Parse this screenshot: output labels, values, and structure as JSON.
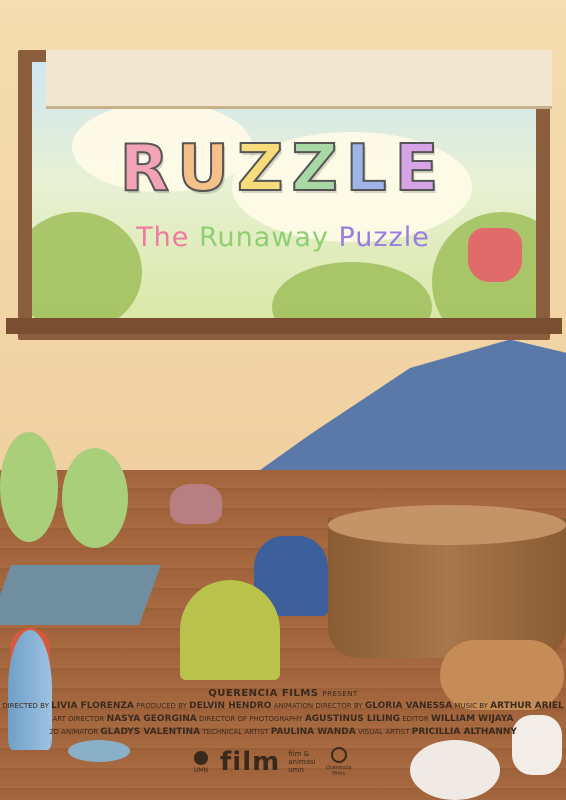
{
  "poster": {
    "title_letters": [
      "R",
      "U",
      "Z",
      "Z",
      "L",
      "E"
    ],
    "title_colors": [
      "#f3a3b6",
      "#f6c08a",
      "#f6dc7a",
      "#a8d8a4",
      "#9fb4e8",
      "#d8a4e8"
    ],
    "subtitle_words": [
      "The",
      "Runaway",
      "Puzzle"
    ],
    "subtitle_colors": [
      "#f07aa0",
      "#8fcf72",
      "#9a7de0"
    ],
    "presenter": "QUERENCIA FILMS",
    "presenter_suffix": "PRESENT"
  },
  "credits": {
    "line1": [
      {
        "role": "DIRECTED BY",
        "name": "LIVIA FLORENZA"
      },
      {
        "role": "PRODUCED BY",
        "name": "DELVIN HENDRO"
      },
      {
        "role": "ANIMATION DIRECTOR BY",
        "name": "GLORIA VANESSA"
      },
      {
        "role": "MUSIC BY",
        "name": "ARTHUR ARIEL"
      }
    ],
    "line2": [
      {
        "role": "ART DIRECTOR",
        "name": "NASYA GEORGINA"
      },
      {
        "role": "DIRECTOR OF PHOTOGRAPHY",
        "name": "AGUSTINUS LILING"
      },
      {
        "role": "EDITOR",
        "name": "WILLIAM WIJAYA"
      }
    ],
    "line3": [
      {
        "role": "2D ANIMATOR",
        "name": "GLADYS VALENTINA"
      },
      {
        "role": "TECHNICAL ARTIST",
        "name": "PAULINA WANDA"
      },
      {
        "role": "VISUAL ARTIST",
        "name": "PRICILLIA ALTHANNY"
      }
    ]
  },
  "logos": {
    "umn": "UMN",
    "film": "film",
    "film_animasi_1": "film &",
    "film_animasi_2": "animasi",
    "film_animasi_3": "umn",
    "querencia_1": "Querencia",
    "querencia_2": "Films"
  }
}
